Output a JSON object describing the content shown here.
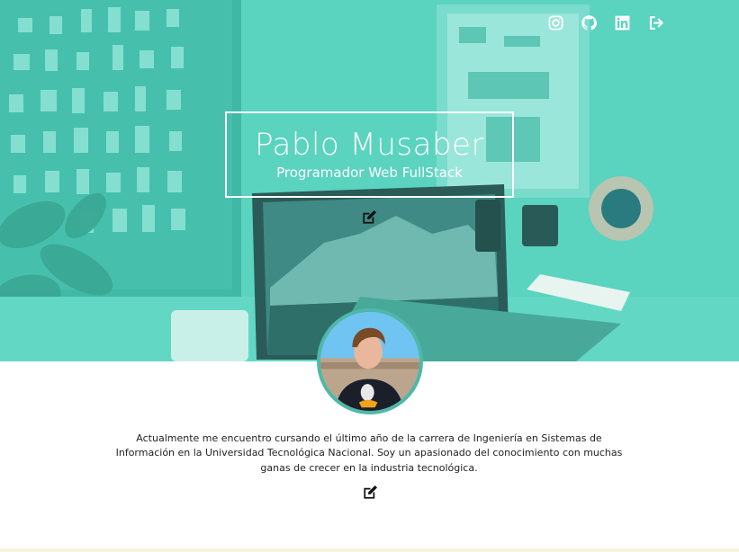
{
  "header": {
    "name": "Pablo Musaber",
    "subtitle": "Programador Web FullStack",
    "edit_icon": "edit-icon"
  },
  "social": [
    {
      "icon": "instagram-icon"
    },
    {
      "icon": "github-icon"
    },
    {
      "icon": "linkedin-icon"
    },
    {
      "icon": "logout-icon"
    }
  ],
  "about": {
    "text": "Actualmente me encuentro cursando el último año de la carrera de Ingeniería en Sistemas de Información en la Universidad Tecnológica Nacional. Soy un apasionado del conocimiento con muchas ganas de crecer en la industria tecnológica.",
    "edit_icon": "edit-icon"
  },
  "colors": {
    "hero_overlay": "#57cdb9",
    "accent": "#4fb8a8",
    "text": "#222222",
    "icon": "#ffffff"
  }
}
